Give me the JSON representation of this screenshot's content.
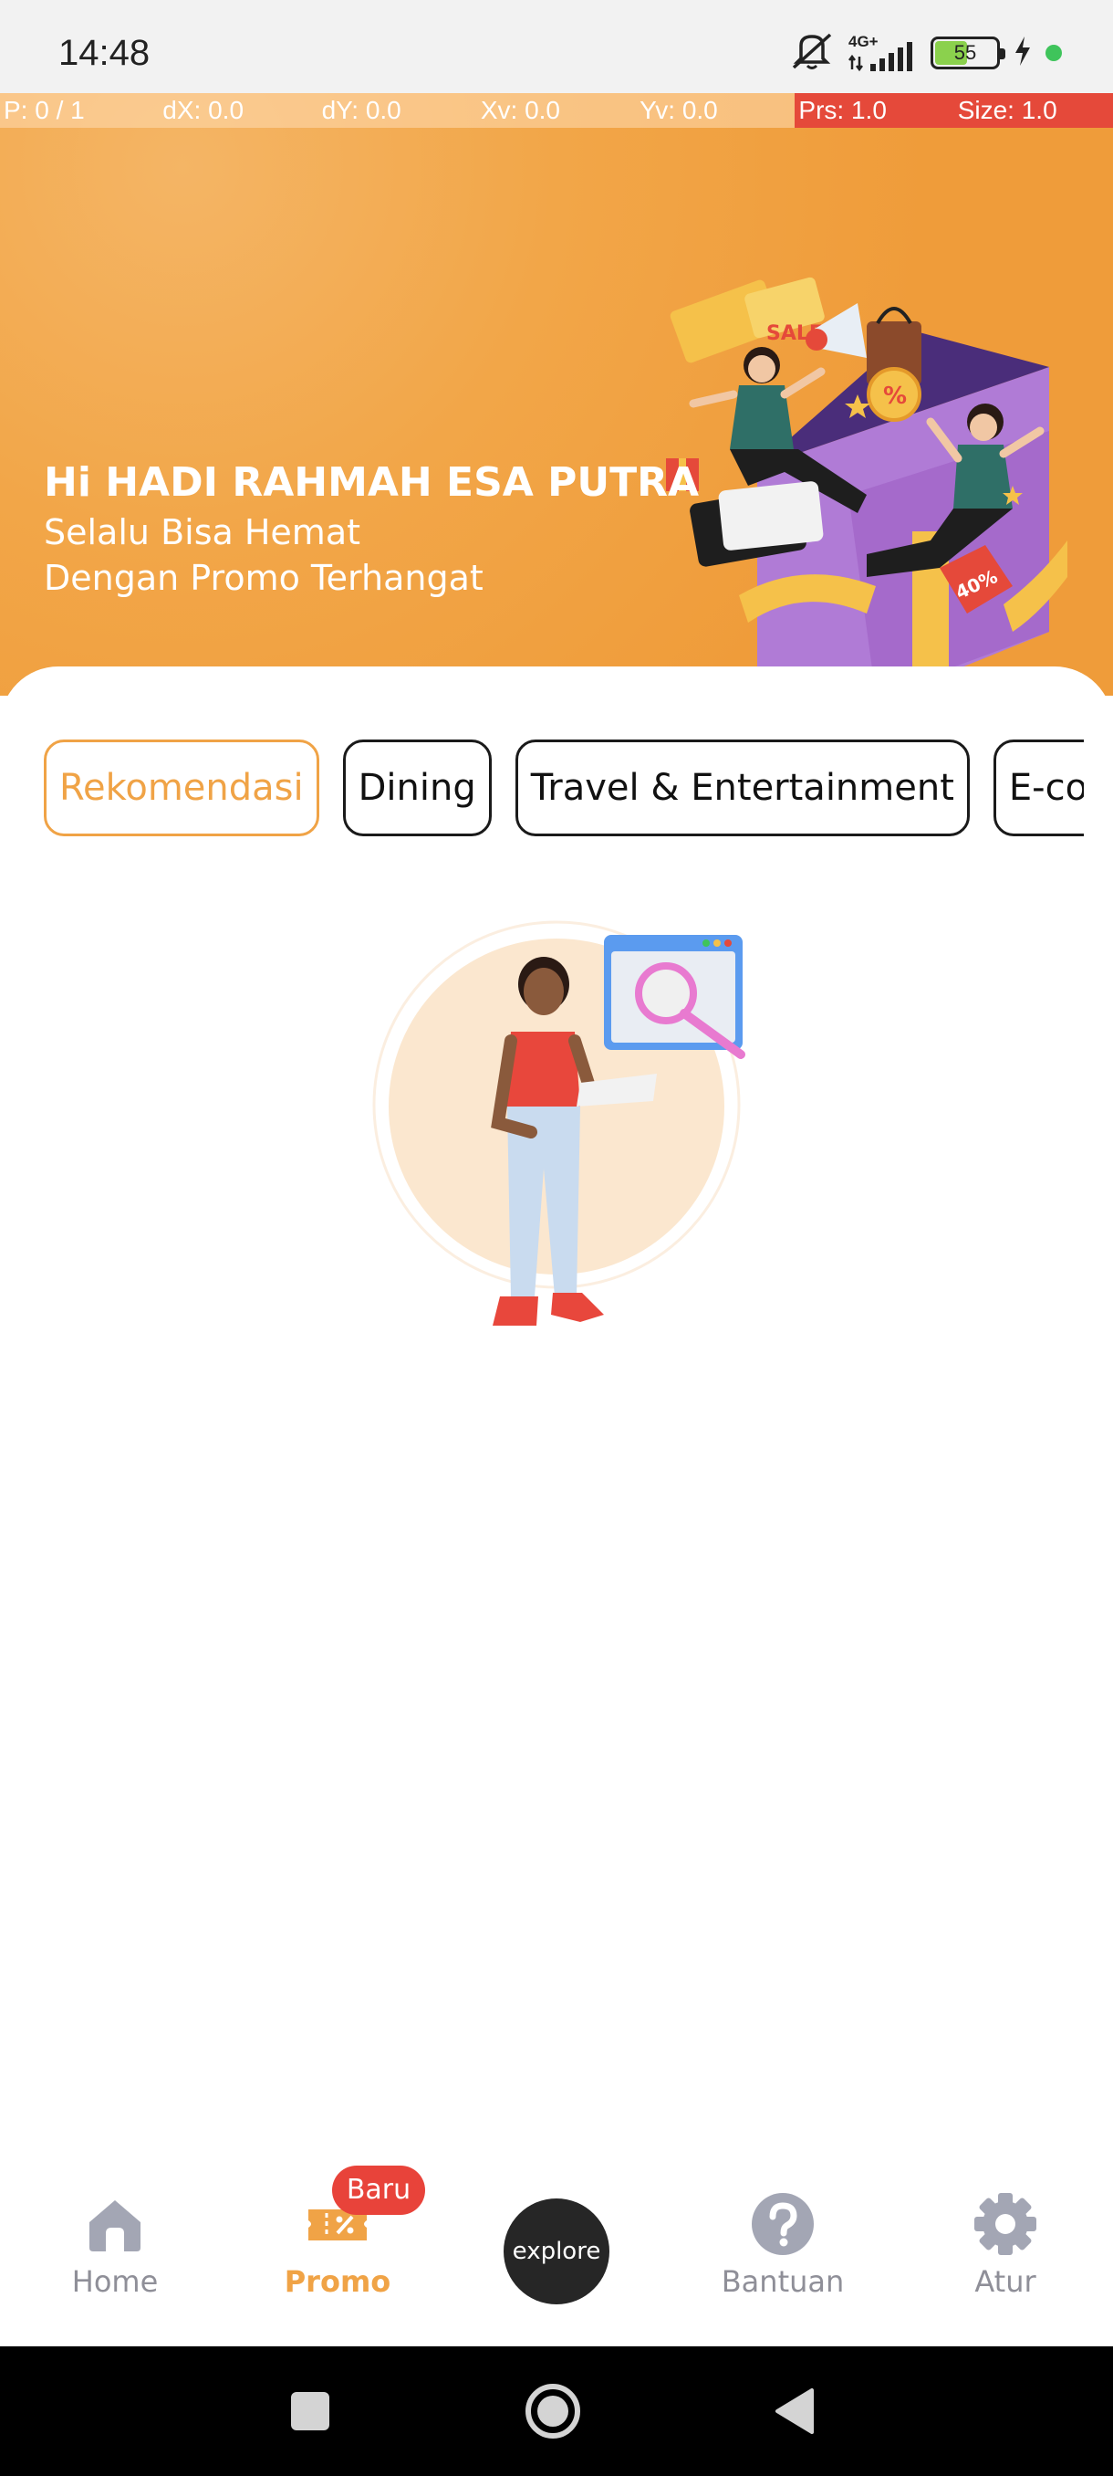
{
  "status_bar": {
    "time": "14:48",
    "network": "4G+",
    "battery": "55",
    "battery_level": 0.55
  },
  "debug_bar": [
    "P: 0 / 1",
    "dX: 0.0",
    "dY: 0.0",
    "Xv: 0.0",
    "Yv: 0.0",
    "Prs: 1.0",
    "Size: 1.0"
  ],
  "banner": {
    "greeting": "Hi HADI RAHMAH ESA PUTRA",
    "line1": "Selalu Bisa Hemat",
    "line2": "Dengan Promo Terhangat"
  },
  "tabs": [
    "Rekomendasi",
    "Dining",
    "Travel & Entertainment",
    "E-commerce"
  ],
  "bottom_nav": {
    "home": "Home",
    "promo": "Promo",
    "promo_badge": "Baru",
    "explore": "explore",
    "help": "Bantuan",
    "settings": "Atur"
  },
  "colors": {
    "accent": "#f0a346",
    "badge": "#e8433a",
    "inactive": "#8f8f98",
    "banner": "#ef9c3a"
  },
  "icons": [
    "home-icon",
    "promo-ticket-icon",
    "help-icon",
    "gear-icon",
    "mute-icon",
    "signal-icon",
    "battery-icon",
    "charging-icon"
  ]
}
